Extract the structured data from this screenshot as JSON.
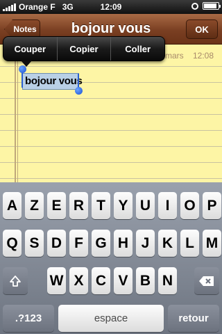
{
  "status_bar": {
    "carrier": "Orange F",
    "network": "3G",
    "time": "12:09"
  },
  "nav": {
    "back_label": "Notes",
    "title": "bojour vous",
    "ok_label": "OK"
  },
  "note": {
    "date": "mars",
    "time": "12:08",
    "selected_text": "bojour vous"
  },
  "edit_menu": {
    "cut": "Couper",
    "copy": "Copier",
    "paste": "Coller"
  },
  "keyboard": {
    "row1": [
      "A",
      "Z",
      "E",
      "R",
      "T",
      "Y",
      "U",
      "I",
      "O",
      "P"
    ],
    "row2": [
      "Q",
      "S",
      "D",
      "F",
      "G",
      "H",
      "J",
      "K",
      "L",
      "M"
    ],
    "row3": [
      "W",
      "X",
      "C",
      "V",
      "B",
      "N"
    ],
    "numbers_label": ".?123",
    "space_label": "espace",
    "return_label": "retour"
  }
}
